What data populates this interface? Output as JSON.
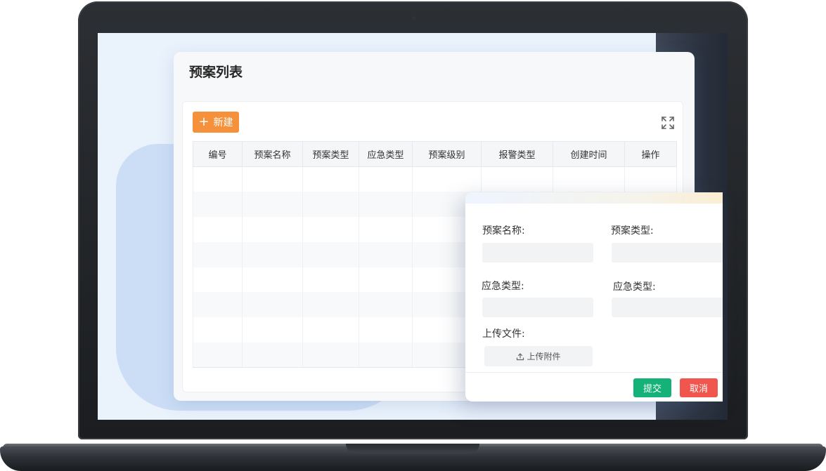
{
  "page": {
    "title": "预案列表",
    "new_button": "新建"
  },
  "table": {
    "columns": [
      "编号",
      "预案名称",
      "预案类型",
      "应急类型",
      "预案级别",
      "报警类型",
      "创建时间",
      "操作"
    ],
    "rows": []
  },
  "modal": {
    "fields": {
      "plan_name": "预案名称:",
      "plan_type": "预案类型:",
      "emergency_type_1": "应急类型:",
      "emergency_type_2": "应急类型:",
      "upload_file": "上传文件:"
    },
    "upload_button": "上传附件",
    "submit_button": "提交",
    "cancel_button": "取消"
  },
  "colors": {
    "accent_orange": "#f5913a",
    "submit_green": "#14b278",
    "cancel_red": "#f0554e"
  },
  "icons": [
    "plus-icon",
    "expand-icon",
    "upload-icon"
  ]
}
